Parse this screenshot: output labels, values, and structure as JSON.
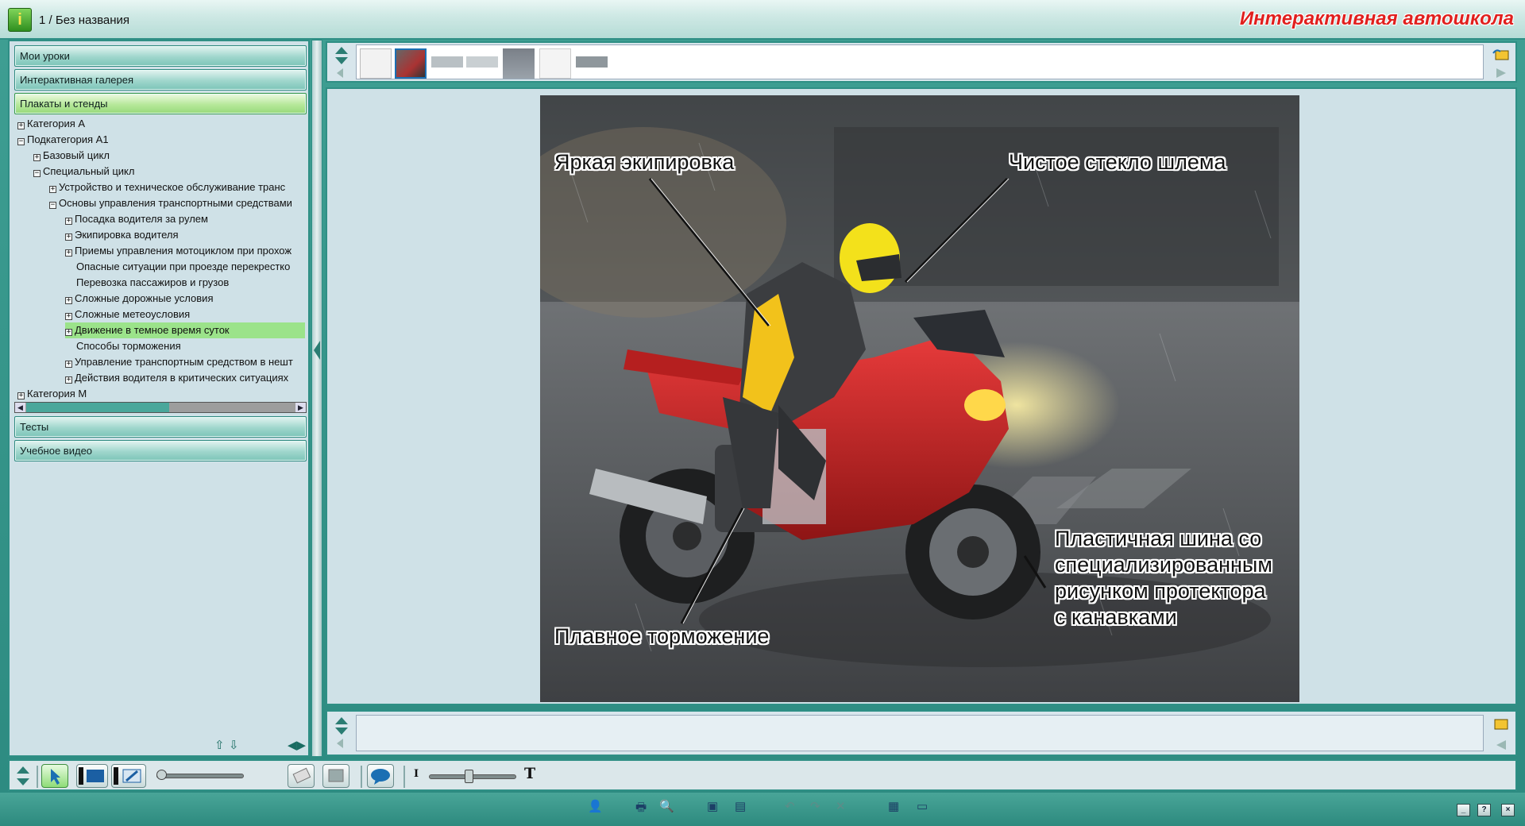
{
  "window": {
    "title": "1 / Без названия",
    "brand": "Интерактивная автошкола"
  },
  "sidebar": {
    "sections_top": [
      {
        "label": "Мои уроки",
        "active": false
      },
      {
        "label": "Интерактивная галерея",
        "active": false
      },
      {
        "label": "Плакаты и стенды",
        "active": true
      }
    ],
    "tree": [
      {
        "label": "Категория А",
        "expander": "+",
        "level": 0
      },
      {
        "label": "Подкатегория А1",
        "expander": "-",
        "level": 0
      },
      {
        "label": "Базовый цикл",
        "expander": "+",
        "level": 1
      },
      {
        "label": "Специальный цикл",
        "expander": "-",
        "level": 1
      },
      {
        "label": "Устройство и техническое обслуживание транс",
        "expander": "+",
        "level": 2
      },
      {
        "label": "Основы управления транспортными средствами",
        "expander": "-",
        "level": 2
      },
      {
        "label": "Посадка водителя за рулем",
        "expander": "+",
        "level": 3
      },
      {
        "label": "Экипировка водителя",
        "expander": "+",
        "level": 3
      },
      {
        "label": "Приемы управления мотоциклом при прохож",
        "expander": "+",
        "level": 3
      },
      {
        "label": "Опасные ситуации при проезде перекрестко",
        "expander": "",
        "level": 3
      },
      {
        "label": "Перевозка пассажиров и грузов",
        "expander": "",
        "level": 3
      },
      {
        "label": "Сложные дорожные условия",
        "expander": "+",
        "level": 3
      },
      {
        "label": "Сложные метеоусловия",
        "expander": "+",
        "level": 3
      },
      {
        "label": "Движение в темное время суток",
        "expander": "+",
        "level": 3,
        "selected": true
      },
      {
        "label": "Способы торможения",
        "expander": "",
        "level": 3
      },
      {
        "label": "Управление транспортным средством в нешт",
        "expander": "+",
        "level": 3
      },
      {
        "label": "Действия водителя в критических ситуациях",
        "expander": "+",
        "level": 3
      },
      {
        "label": "Категория М",
        "expander": "+",
        "level": 0
      }
    ],
    "sections_bottom": [
      {
        "label": "Тесты"
      },
      {
        "label": "Учебное видео"
      }
    ]
  },
  "poster": {
    "callouts": {
      "equipment": "Яркая экипировка",
      "visor": "Чистое стекло шлема",
      "braking": "Плавное торможение",
      "tire_line1": "Пластичная шина со",
      "tire_line2": "специализированным",
      "tire_line3": "рисунком протектора",
      "tire_line4": "с канавками"
    }
  },
  "toolbar": {
    "font_small_glyph": "I",
    "font_large_glyph": "T",
    "size_slider_value": 0.05,
    "font_slider_value": 0.45
  },
  "colors": {
    "accent": "#2f8f85",
    "brand": "#e0201e",
    "selection": "#9be38a"
  }
}
